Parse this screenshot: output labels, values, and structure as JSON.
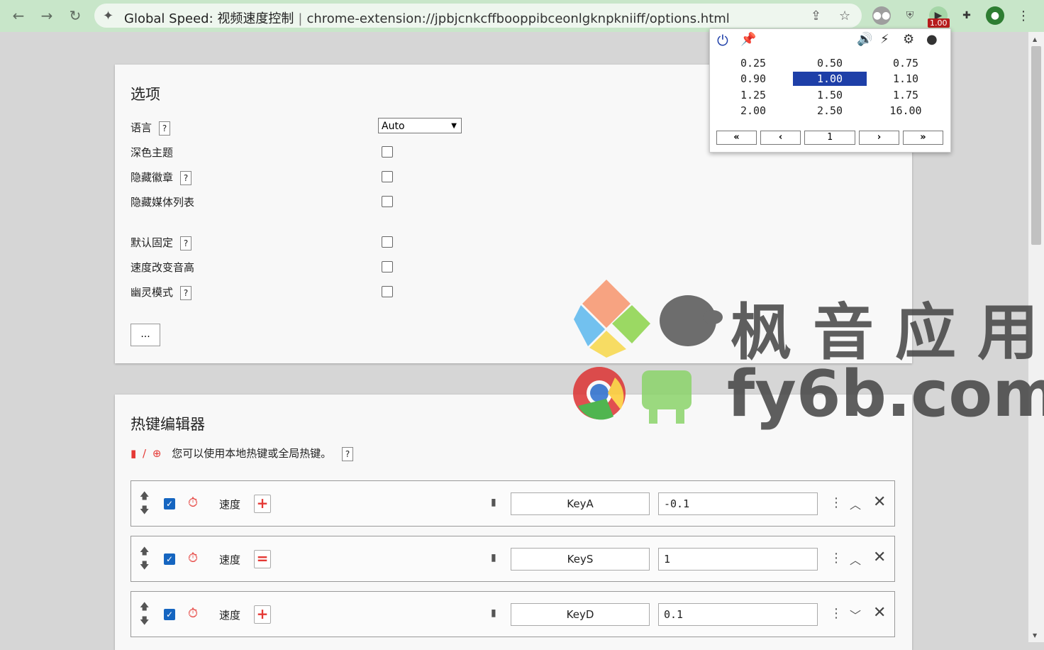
{
  "browser": {
    "tab_title": "Global Speed: 视频速度控制",
    "url": "chrome-extension://jpbjcnkcffbooppibceonlgknpkniiff/options.html",
    "badge": "1.00"
  },
  "options": {
    "title": "选项",
    "items": [
      {
        "label": "语言",
        "help": "?"
      },
      {
        "label": "深色主题"
      },
      {
        "label": "隐藏徽章",
        "help": "?"
      },
      {
        "label": "隐藏媒体列表"
      },
      {
        "label": "默认固定",
        "help": "?"
      },
      {
        "label": "速度改变音高"
      },
      {
        "label": "幽灵模式",
        "help": "?"
      }
    ],
    "language_value": "Auto",
    "more_label": "..."
  },
  "hotkeys": {
    "title": "热键编辑器",
    "description": "您可以使用本地热键或全局热键。",
    "help": "?",
    "rows": [
      {
        "label": "速度",
        "op": "+",
        "key": "KeyA",
        "value": "-0.1"
      },
      {
        "label": "速度",
        "op": "=",
        "key": "KeyS",
        "value": "1"
      },
      {
        "label": "速度",
        "op": "+",
        "key": "KeyD",
        "value": "0.1"
      }
    ]
  },
  "popup": {
    "speeds": [
      "0.25",
      "0.50",
      "0.75",
      "0.90",
      "1.00",
      "1.10",
      "1.25",
      "1.50",
      "1.75",
      "2.00",
      "2.50",
      "16.00"
    ],
    "active_speed": "1.00",
    "nav": [
      "«",
      "‹",
      "1",
      "›",
      "»"
    ]
  },
  "watermark": {
    "line1": "枫音应用",
    "line2": "fy6b.com"
  },
  "colors": {
    "topbar": "#c8e6c9",
    "accent_blue": "#1e3fa8",
    "red": "#e53935"
  }
}
